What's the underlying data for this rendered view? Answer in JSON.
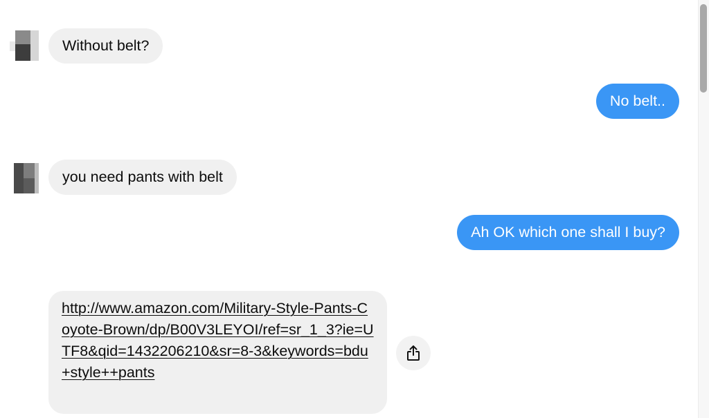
{
  "conversation": {
    "messages": [
      {
        "direction": "incoming",
        "text": "Without belt?"
      },
      {
        "direction": "outgoing",
        "text": "No belt.."
      },
      {
        "direction": "incoming",
        "text": "you need pants with belt"
      },
      {
        "direction": "outgoing",
        "text": "Ah OK which one shall I buy?"
      },
      {
        "direction": "incoming",
        "type": "link",
        "text": "http://www.amazon.com/Military-Style-Pants-Coyote-Brown/dp/B00V3LEYOI/ref=sr_1_3?ie=UTF8&qid=1432206210&sr=8-3&keywords=bdu+style++pants"
      }
    ]
  },
  "icons": {
    "share": "share-icon",
    "avatar": "contact-avatar"
  },
  "colors": {
    "outgoing_bubble": "#3a96f5",
    "incoming_bubble": "#f0f0f0",
    "text_dark": "#0c0c0c",
    "background": "#ffffff"
  }
}
